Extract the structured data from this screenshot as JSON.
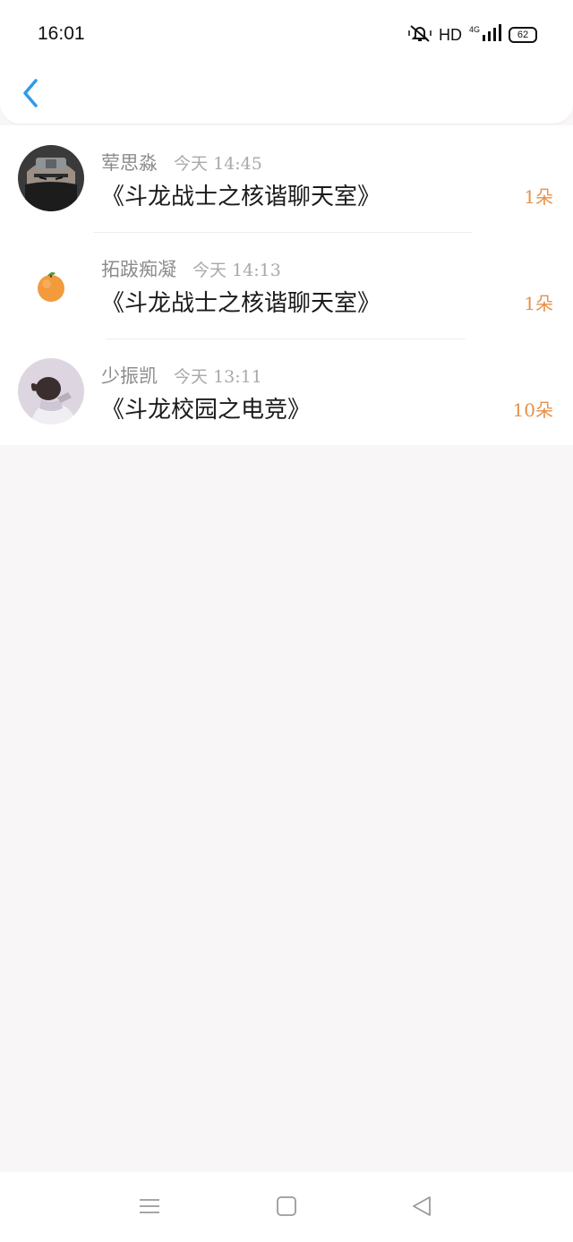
{
  "status_bar": {
    "time": "16:01",
    "hd_label": "HD",
    "network_label": "4G",
    "battery_level": "62"
  },
  "header": {
    "back_icon": "chevron-left-icon",
    "accent_color": "#2f9be8"
  },
  "messages": [
    {
      "sender": "荤思淼",
      "date_word": "今天",
      "time": "14:45",
      "room": "《斗龙战士之核谐聊天室》",
      "count": "1朵",
      "avatar": "ninja-avatar"
    },
    {
      "sender": "拓跋痴凝",
      "date_word": "今天",
      "time": "14:13",
      "room": "《斗龙战士之核谐聊天室》",
      "count": "1朵",
      "avatar": "orange-avatar"
    },
    {
      "sender": "少振凯",
      "date_word": "今天",
      "time": "13:11",
      "room": "《斗龙校园之电竞》",
      "count": "10朵",
      "avatar": "person-photo-avatar"
    }
  ],
  "colors": {
    "count": "#e89048",
    "sender": "#8c8c8c",
    "background": "#f8f6f7"
  },
  "nav_bar": {
    "menu_icon": "menu-icon",
    "home_icon": "home-square-icon",
    "back_icon": "back-triangle-icon"
  }
}
